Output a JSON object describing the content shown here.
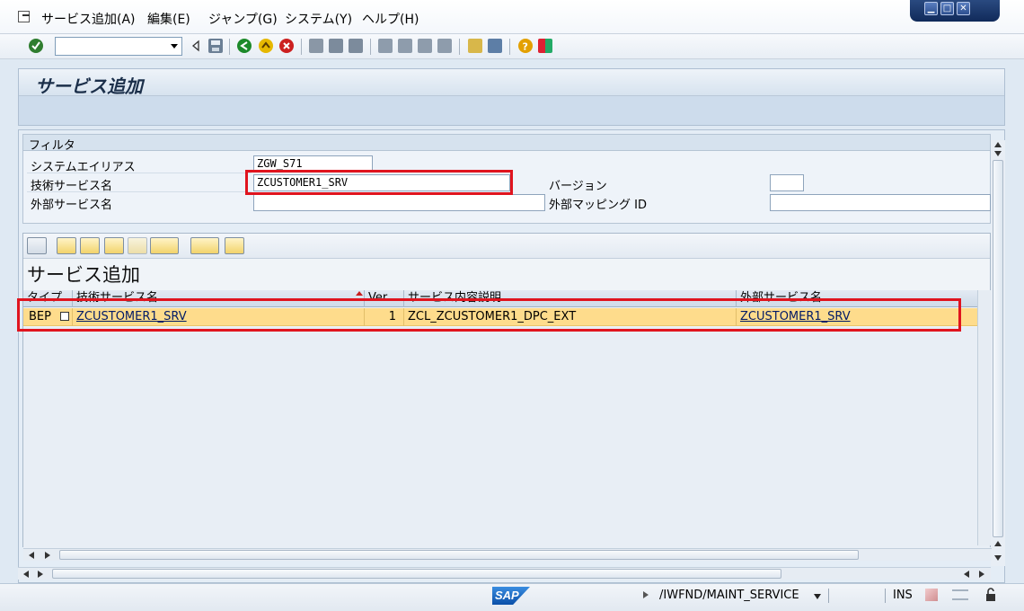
{
  "menubar": {
    "items": [
      "サービス追加(A)",
      "編集(E)",
      "ジャンプ(G)",
      "システム(Y)",
      "ヘルプ(H)"
    ]
  },
  "window_controls": {
    "minimize": "▁",
    "maximize": "□",
    "close": "✕"
  },
  "toolbar": {
    "command_field_value": "",
    "icons": [
      "enter-icon",
      "back-icon",
      "exit-icon",
      "cancel-icon",
      "print-icon",
      "find-icon",
      "find-next-icon",
      "first-page-icon",
      "prev-page-icon",
      "next-page-icon",
      "last-page-icon",
      "new-session-icon",
      "shortcut-icon",
      "help-icon",
      "layout-icon"
    ]
  },
  "page_title": "サービス追加",
  "filter": {
    "header": "フィルタ",
    "system_alias_label": "システムエイリアス",
    "system_alias_value": "ZGW_S71",
    "tech_service_label": "技術サービス名",
    "tech_service_value": "ZCUSTOMER1_SRV",
    "version_label": "バージョン",
    "version_value": "",
    "ext_service_label": "外部サービス名",
    "ext_service_value": "",
    "ext_mapping_label": "外部マッピング ID",
    "ext_mapping_value": ""
  },
  "alv": {
    "title": "サービス追加",
    "columns": [
      "タイプ",
      "技術サービス名",
      "Ver...",
      "サービス内容説明",
      "外部サービス名"
    ],
    "rows": [
      {
        "type": "BEP",
        "tech_name": "ZCUSTOMER1_SRV",
        "version": "1",
        "description": "ZCL_ZCUSTOMER1_DPC_EXT",
        "ext_name": "ZCUSTOMER1_SRV"
      }
    ]
  },
  "status": {
    "transaction": "/IWFND/MAINT_SERVICE",
    "mode": "INS",
    "logo": "SAP"
  },
  "colors": {
    "highlight": "#e0141e",
    "row_selected": "#fedc8c",
    "title_text": "#1b2f4a"
  }
}
